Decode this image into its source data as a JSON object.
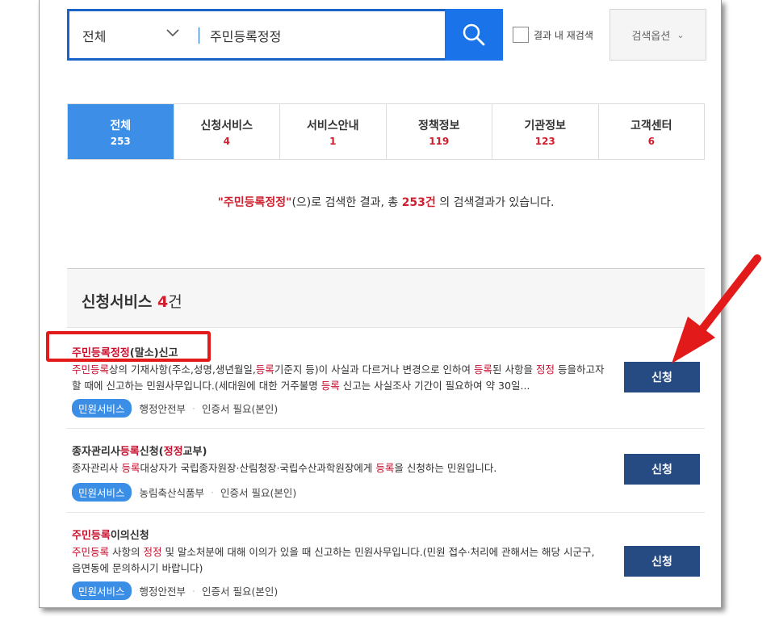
{
  "search": {
    "scope": "전체",
    "query": "주민등록정정",
    "recheck_label": "결과 내 재검색",
    "options_label": "검색옵션"
  },
  "tabs": [
    {
      "label": "전체",
      "count": "253"
    },
    {
      "label": "신청서비스",
      "count": "4"
    },
    {
      "label": "서비스안내",
      "count": "1"
    },
    {
      "label": "정책정보",
      "count": "119"
    },
    {
      "label": "기관정보",
      "count": "123"
    },
    {
      "label": "고객센터",
      "count": "6"
    }
  ],
  "summary": {
    "term": "\"주민등록정정\"",
    "middle": "(으)로 검색한 결과, 총 ",
    "total": "253건",
    "end": " 의 검색결과가 있습니다."
  },
  "section": {
    "title": "신청서비스",
    "count": "4",
    "unit": "건"
  },
  "items": [
    {
      "title_red": "주민등록정정",
      "title_rest": "(말소)신고",
      "desc_parts": [
        "주민등록",
        "상의 기재사항(주소,성명,생년월일,",
        "등록",
        "기준지 등)이 사실과 다르거나 변경으로 인하여 ",
        "등록",
        "된 사항을 ",
        "정정",
        " 등을하고자 할 때에 신고하는 민원사무입니다.(세대원에 대한 거주불명 ",
        "등록",
        " 신고는 사실조사 기간이 필요하여 약 30일..."
      ],
      "badge": "민원서비스",
      "agency": "행정안전부",
      "cert": "인증서 필요(본인)",
      "button": "신청"
    },
    {
      "title_parts": [
        "종자관리사",
        "등록",
        "신청(",
        "정정",
        "교부)"
      ],
      "desc_parts": [
        "종자관리사 ",
        "등록",
        "대상자가 국립종자원장·산림청장·국립수산과학원장에게 ",
        "등록",
        "을 신청하는 민원입니다."
      ],
      "badge": "민원서비스",
      "agency": "농림축산식품부",
      "cert": "인증서 필요(본인)",
      "button": "신청"
    },
    {
      "title_red": "주민등록",
      "title_rest": "이의신청",
      "desc_parts": [
        "주민등록",
        " 사항의 ",
        "정정",
        " 및 말소처분에 대해 이의가 있을 때 신고하는 민원사무입니다.(민원 접수·처리에 관해서는 해당 시군구, 읍면동에 문의하시기 바랍니다)"
      ],
      "badge": "민원서비스",
      "agency": "행정안전부",
      "cert": "인증서 필요(본인)",
      "button": "신청"
    }
  ],
  "colors": {
    "accent": "#1a73e8",
    "highlight": "#d0202e",
    "button": "#264b82",
    "annotation": "#e31a1a"
  }
}
